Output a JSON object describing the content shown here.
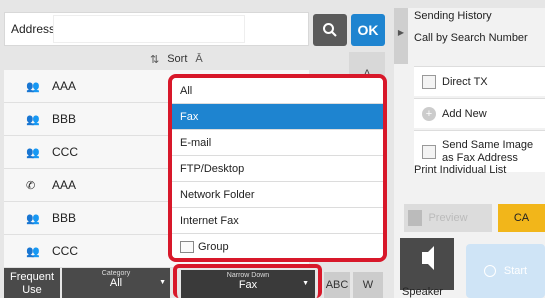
{
  "address": {
    "label": "Address",
    "value": ""
  },
  "toolbar": {
    "ok_label": "OK",
    "sort_label": "Sort"
  },
  "index_tab": "A",
  "list": [
    {
      "icon": "group-icon",
      "name": "AAA"
    },
    {
      "icon": "group-icon",
      "name": "BBB"
    },
    {
      "icon": "group-icon",
      "name": "CCC"
    },
    {
      "icon": "phone-icon",
      "name": "AAA"
    },
    {
      "icon": "group-icon",
      "name": "BBB"
    },
    {
      "icon": "group-icon",
      "name": "CCC"
    }
  ],
  "dropdown": {
    "items": [
      "All",
      "Fax",
      "E-mail",
      "FTP/Desktop",
      "Network Folder",
      "Internet Fax",
      "Group"
    ],
    "selected": "Fax"
  },
  "bottom": {
    "frequent": {
      "line1": "Frequent",
      "line2": "Use"
    },
    "category": {
      "caption": "Category",
      "value": "All"
    },
    "narrow_down": {
      "caption": "Narrow Down",
      "value": "Fax"
    },
    "abc_label": "ABC",
    "w_label": "W"
  },
  "right_panel": {
    "sending_history": "Sending History",
    "call_by_search": "Call by Search Number",
    "direct_tx": "Direct TX",
    "add_new": "Add New",
    "send_same_image": {
      "line1": "Send Same Image",
      "line2": "as Fax Address"
    },
    "print_individual": "Print Individual List",
    "preview": "Preview",
    "ca": "CA",
    "speaker": "Speaker",
    "start": "Start"
  },
  "colors": {
    "accent": "#1e84d0",
    "highlight": "#d8182a",
    "ca": "#f2b61a"
  }
}
